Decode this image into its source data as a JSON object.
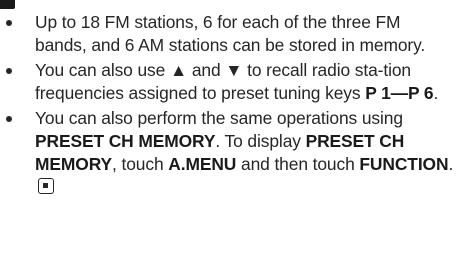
{
  "notes": [
    {
      "text": "Up to 18 FM stations, 6 for each of the three FM bands, and 6 AM stations can be stored in memory."
    },
    {
      "part1": "You can also use ",
      "up_symbol": "▲",
      "part2": " and ",
      "down_symbol": "▼",
      "part3": " to recall radio sta-tion frequencies assigned to preset tuning keys ",
      "keys": "P 1—P 6",
      "part4": "."
    },
    {
      "part1": "You can also perform the same operations using ",
      "menu_name": "PRESET CH MEMORY",
      "part2": ". To display ",
      "menu_name_2": "PRESET CH MEMORY",
      "part3": ", touch ",
      "button_1": "A.MENU",
      "part4": " and then touch ",
      "button_2": "FUNCTION",
      "part5": ".",
      "end_icon": "end-of-section-icon"
    }
  ]
}
